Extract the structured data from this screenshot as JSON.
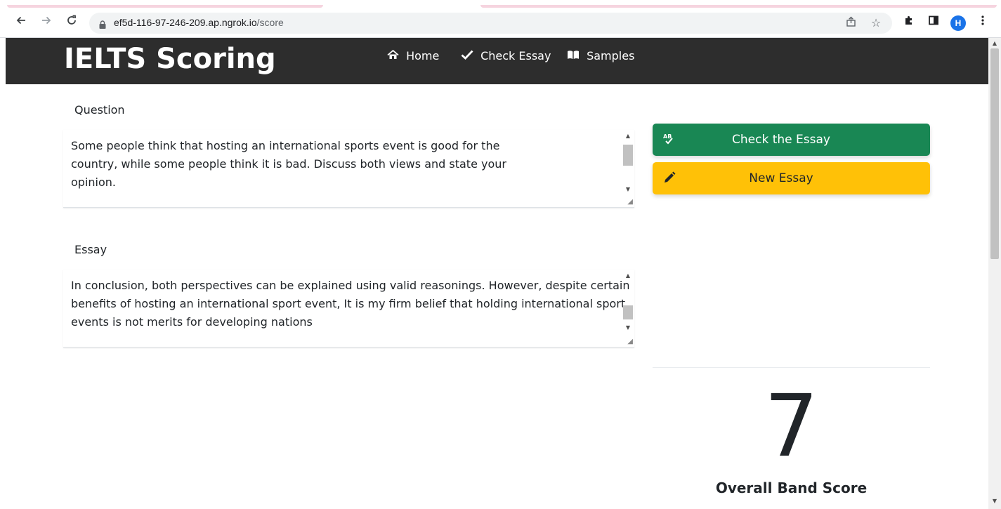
{
  "browser": {
    "url_host": "ef5d-116-97-246-209.ap.ngrok.io",
    "url_path": "/score",
    "profile_initial": "H",
    "back_icon": "arrow-left-icon",
    "forward_icon": "arrow-right-icon",
    "reload_icon": "reload-icon",
    "share_icon": "share-icon",
    "bookmark_icon": "star-icon",
    "extensions_icon": "puzzle-icon",
    "sidepanel_icon": "side-panel-icon",
    "menu_icon": "kebab-menu-icon"
  },
  "navbar": {
    "brand": "IELTS Scoring",
    "links": [
      {
        "label": "Home",
        "icon": "home-icon"
      },
      {
        "label": "Check Essay",
        "icon": "check-icon"
      },
      {
        "label": "Samples",
        "icon": "book-open-icon"
      }
    ],
    "background": "#2d2d2d"
  },
  "form": {
    "question_label": "Question",
    "question_text": "Some people think that hosting an international sports event is good for the\ncountry, while some people think it is bad. Discuss both views and state your\nopinion.",
    "essay_label": "Essay",
    "essay_text": "In conclusion, both perspectives can be explained using valid reasonings. However, despite certain\nbenefits of hosting an international sport event, It is my firm belief that holding international sport\nevents is not merits for developing nations"
  },
  "actions": {
    "check_label": "Check the Essay",
    "check_icon": "spellcheck-icon",
    "check_color": "#198754",
    "new_label": "New Essay",
    "new_icon": "pencil-icon",
    "new_color": "#ffc107"
  },
  "result": {
    "score": "7",
    "caption": "Overall Band Score"
  }
}
